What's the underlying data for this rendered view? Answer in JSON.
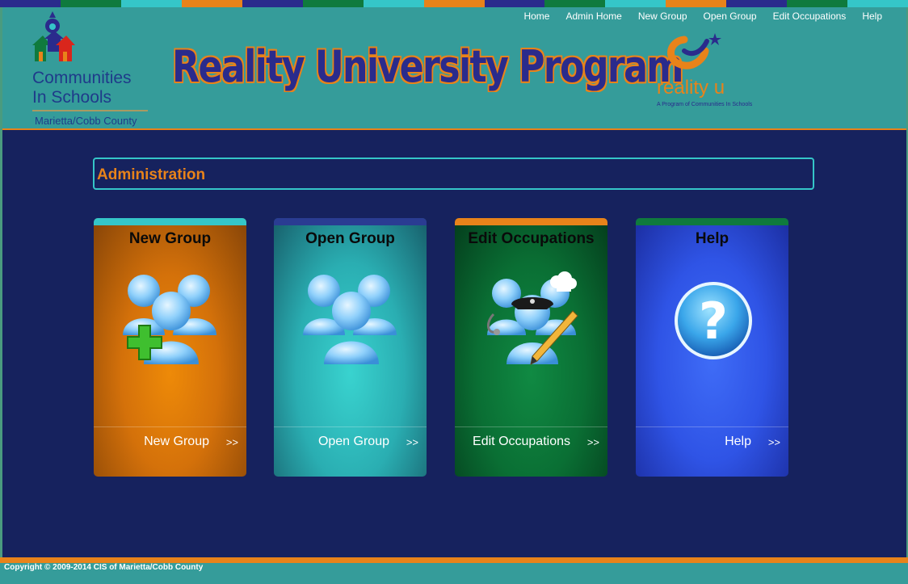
{
  "stripe_colors": [
    "#2a2b8c",
    "#0f7a3d",
    "#35c6c8",
    "#e8831a",
    "#2a2b8c",
    "#0f7a3d",
    "#35c6c8",
    "#e8831a",
    "#2a2b8c",
    "#0f7a3d",
    "#35c6c8",
    "#e8831a",
    "#2a2b8c",
    "#0f7a3d",
    "#35c6c8"
  ],
  "nav": {
    "home": "Home",
    "admin_home": "Admin Home",
    "new_group": "New Group",
    "open_group": "Open Group",
    "edit_occupations": "Edit Occupations",
    "help": "Help"
  },
  "branding": {
    "org_name_line1": "Communities",
    "org_name_line2": "In Schools",
    "county": "Marietta/Cobb County",
    "title": "Reality University Program",
    "ru_word": "reality u",
    "ru_sub": "A Program of Communities In Schools"
  },
  "section": {
    "heading": "Administration"
  },
  "cards": [
    {
      "title": "New Group",
      "link": "New Group",
      "arrow": ">>",
      "icon": "add-group-icon",
      "cap_color": "#35c6c8"
    },
    {
      "title": "Open Group",
      "link": "Open Group",
      "arrow": ">>",
      "icon": "group-icon",
      "cap_color": "#2a3c92"
    },
    {
      "title": "Edit Occupations",
      "link": "Edit Occupations",
      "arrow": ">>",
      "icon": "occupations-edit-icon",
      "cap_color": "#e8831a"
    },
    {
      "title": "Help",
      "link": "Help",
      "arrow": ">>",
      "icon": "help-icon",
      "cap_color": "#0f7a3d"
    }
  ],
  "footer": {
    "copyright": "Copyright © 2009-2014 CIS of Marietta/Cobb County"
  }
}
